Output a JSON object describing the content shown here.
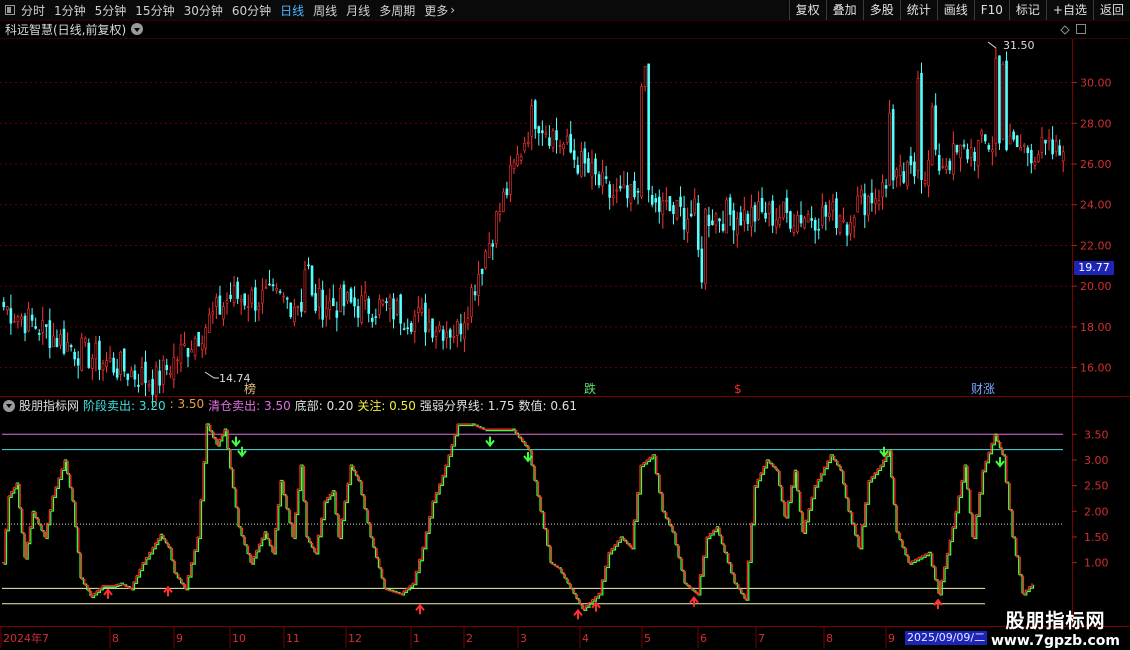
{
  "toolbar": {
    "periods": [
      {
        "label": "分时",
        "active": false
      },
      {
        "label": "1分钟",
        "active": false
      },
      {
        "label": "5分钟",
        "active": false
      },
      {
        "label": "15分钟",
        "active": false
      },
      {
        "label": "30分钟",
        "active": false
      },
      {
        "label": "60分钟",
        "active": false
      },
      {
        "label": "日线",
        "active": true
      },
      {
        "label": "周线",
        "active": false
      },
      {
        "label": "月线",
        "active": false
      },
      {
        "label": "多周期",
        "active": false
      },
      {
        "label": "更多",
        "active": false
      }
    ],
    "tools": [
      "复权",
      "叠加",
      "多股",
      "统计",
      "画线",
      "F10",
      "标记",
      "+自选",
      "返回"
    ]
  },
  "main_chart": {
    "title": "科远智慧(日线,前复权)",
    "high_label": "31.50",
    "low_label": "14.74",
    "current_price": "19.77",
    "price_ticks": [
      "30.00",
      "28.00",
      "26.00",
      "24.00",
      "22.00",
      "20.00",
      "18.00",
      "16.00"
    ],
    "event_markers": [
      {
        "text": "榜",
        "color": "#e8c080"
      },
      {
        "text": "跌",
        "color": "#5fe070"
      },
      {
        "text": "$",
        "color": "#e03030"
      },
      {
        "text": "财涨",
        "color": "#7aa8ff"
      }
    ]
  },
  "indicator": {
    "name": "股朋指标网",
    "params": [
      {
        "text": "阶段卖出: 3.20",
        "color": "#40e0e0"
      },
      {
        "text": ": 3.50",
        "color": "#e8a040"
      },
      {
        "text": "清仓卖出: 3.50",
        "color": "#e070e0"
      },
      {
        "text": "底部: 0.20",
        "color": "#e0e0e0"
      },
      {
        "text": "关注: 0.50",
        "color": "#f0f040"
      },
      {
        "text": "强弱分界线: 1.75",
        "color": "#e0e0e0"
      },
      {
        "text": "数值: 0.61",
        "color": "#e0e0e0"
      }
    ],
    "axis_ticks": [
      "3.50",
      "3.00",
      "2.50",
      "2.00",
      "1.50",
      "1.00"
    ]
  },
  "time_axis": {
    "labels": [
      "2024年7",
      "8",
      "9",
      "10",
      "11",
      "12",
      "1",
      "2",
      "3",
      "4",
      "5",
      "6",
      "7",
      "8",
      "9"
    ],
    "selected_date": "2025/09/09/二"
  },
  "watermark": {
    "name": "股朋指标网",
    "url": "www.7gpzb.com"
  },
  "chart_data": {
    "type": "candlestick",
    "title": "科远智慧(日线,前复权)",
    "price_range": [
      14.5,
      32.0
    ],
    "price_close_trajectory": [
      {
        "month": "2024-07",
        "close": 19.0
      },
      {
        "month": "2024-08",
        "close": 16.8
      },
      {
        "month": "2024-09",
        "close": 15.3
      },
      {
        "month": "2024-10",
        "close": 19.5
      },
      {
        "month": "2024-11",
        "close": 19.2
      },
      {
        "month": "2024-12",
        "close": 19.0
      },
      {
        "month": "2025-01",
        "close": 17.8
      },
      {
        "month": "2025-02",
        "close": 28.5
      },
      {
        "month": "2025-03",
        "close": 24.5
      },
      {
        "month": "2025-04",
        "close": 23.5
      },
      {
        "month": "2025-05",
        "close": 23.5
      },
      {
        "month": "2025-06",
        "close": 23.5
      },
      {
        "month": "2025-07",
        "close": 25.5
      },
      {
        "month": "2025-08",
        "close": 27.0
      },
      {
        "month": "2025-09",
        "close": 26.5
      }
    ],
    "indicator_series": {
      "name": "数值",
      "ylim": [
        0,
        3.9
      ],
      "reference_lines": {
        "阶段卖出": 3.2,
        "清仓卖出": 3.5,
        "强弱分界线": 1.75,
        "关注": 0.5,
        "底部": 0.2
      }
    }
  }
}
